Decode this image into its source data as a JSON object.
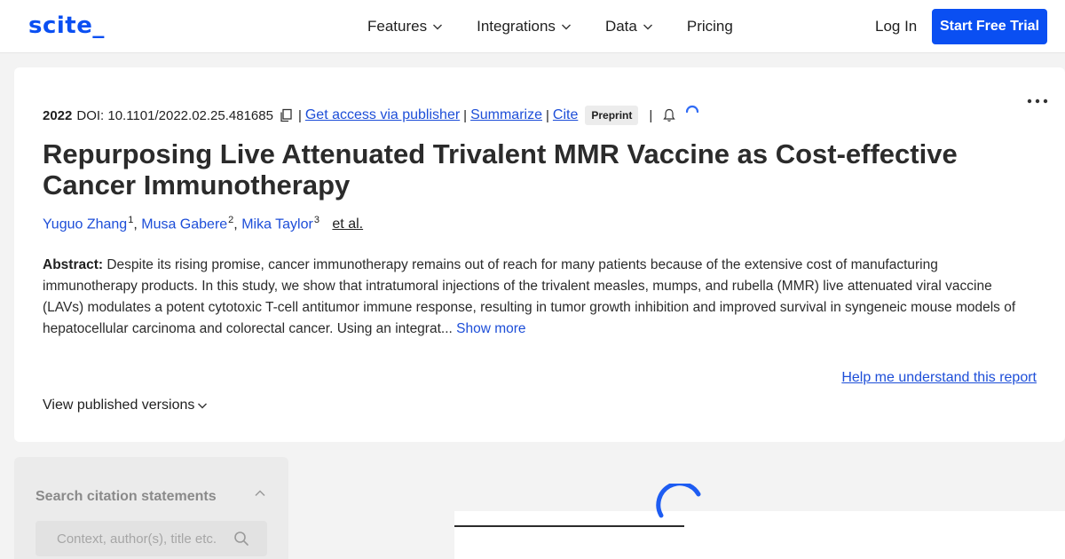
{
  "header": {
    "logo": "scite_",
    "nav": [
      {
        "label": "Features",
        "has_dropdown": true
      },
      {
        "label": "Integrations",
        "has_dropdown": true
      },
      {
        "label": "Data",
        "has_dropdown": true
      },
      {
        "label": "Pricing",
        "has_dropdown": false
      }
    ],
    "login_label": "Log In",
    "trial_label": "Start Free Trial"
  },
  "paper": {
    "year": "2022",
    "doi": "DOI: 10.1101/2022.02.25.481685",
    "links": {
      "access": "Get access via publisher",
      "summarize": "Summarize",
      "cite": "Cite"
    },
    "separator": "|",
    "badge": "Preprint",
    "title": "Repurposing Live Attenuated Trivalent MMR Vaccine as Cost-effective Cancer Immunotherapy",
    "authors": [
      {
        "name": "Yuguo Zhang",
        "affil": "1"
      },
      {
        "name": "Musa Gabere",
        "affil": "2"
      },
      {
        "name": "Mika Taylor",
        "affil": "3"
      }
    ],
    "author_separator": ",",
    "et_al": "et al.",
    "abstract_label": "Abstract:",
    "abstract_text": " Despite its rising promise, cancer immunotherapy remains out of reach for many patients because of the extensive cost of manufacturing immunotherapy products. In this study, we show that intratumoral injections of the trivalent measles, mumps, and rubella (MMR) live attenuated viral vaccine (LAVs) modulates a potent cytotoxic T-cell antitumor immune response, resulting in tumor growth inhibition and improved survival in syngeneic mouse models of hepatocellular carcinoma and colorectal cancer. Using an integrat...",
    "show_more": "Show more",
    "help_link": "Help me understand this report",
    "versions_label": "View published versions"
  },
  "search": {
    "label": "Search citation statements",
    "placeholder": "Context, author(s), title etc."
  },
  "colors": {
    "brand": "#0a4ff2",
    "link": "#1d4ed8",
    "page_bg": "#f3f3f3"
  },
  "icons": {
    "nav_dropdown": "chevron-down-icon",
    "doi_copy": "copy-icon",
    "alert": "bell-icon",
    "status": "spinner-icon",
    "menu": "more-options-icon",
    "panel_toggle": "chevron-up-icon",
    "search": "search-icon"
  }
}
